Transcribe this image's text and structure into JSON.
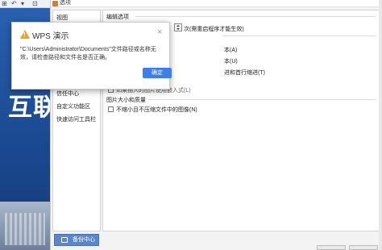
{
  "background": {
    "big_text": "互联",
    "title_glyphs": [
      "⊞",
      "↶",
      "▾",
      "⊡"
    ]
  },
  "options_dialog": {
    "title": "选项",
    "nav": [
      "视图",
      "信任中心",
      "自定义功能区",
      "快速访问工具栏"
    ],
    "section_edit": "编辑选项",
    "spin_suffix": "次(需重启程序才能生效)",
    "opt_text1": "本(A)",
    "opt_text2": "本(U)",
    "opt_text3": "进和首行缩进(T)",
    "opt_text4": "如果插入的图片使用嵌入式(L)",
    "section_image": "图片大小和质量",
    "no_compress": "不缩小且不压缩文件中的图像(N)",
    "backup_label": "备份中心"
  },
  "alert": {
    "title": "WPS 演示",
    "message": "\"C:\\Users\\Administrator\\Documents\"文件路径或名称无效，请检查路径和文件名是否正确。",
    "ok_label": "确定",
    "close_glyph": "×",
    "warn_color": "#f0a01c",
    "button_color": "#3d7ee8"
  }
}
